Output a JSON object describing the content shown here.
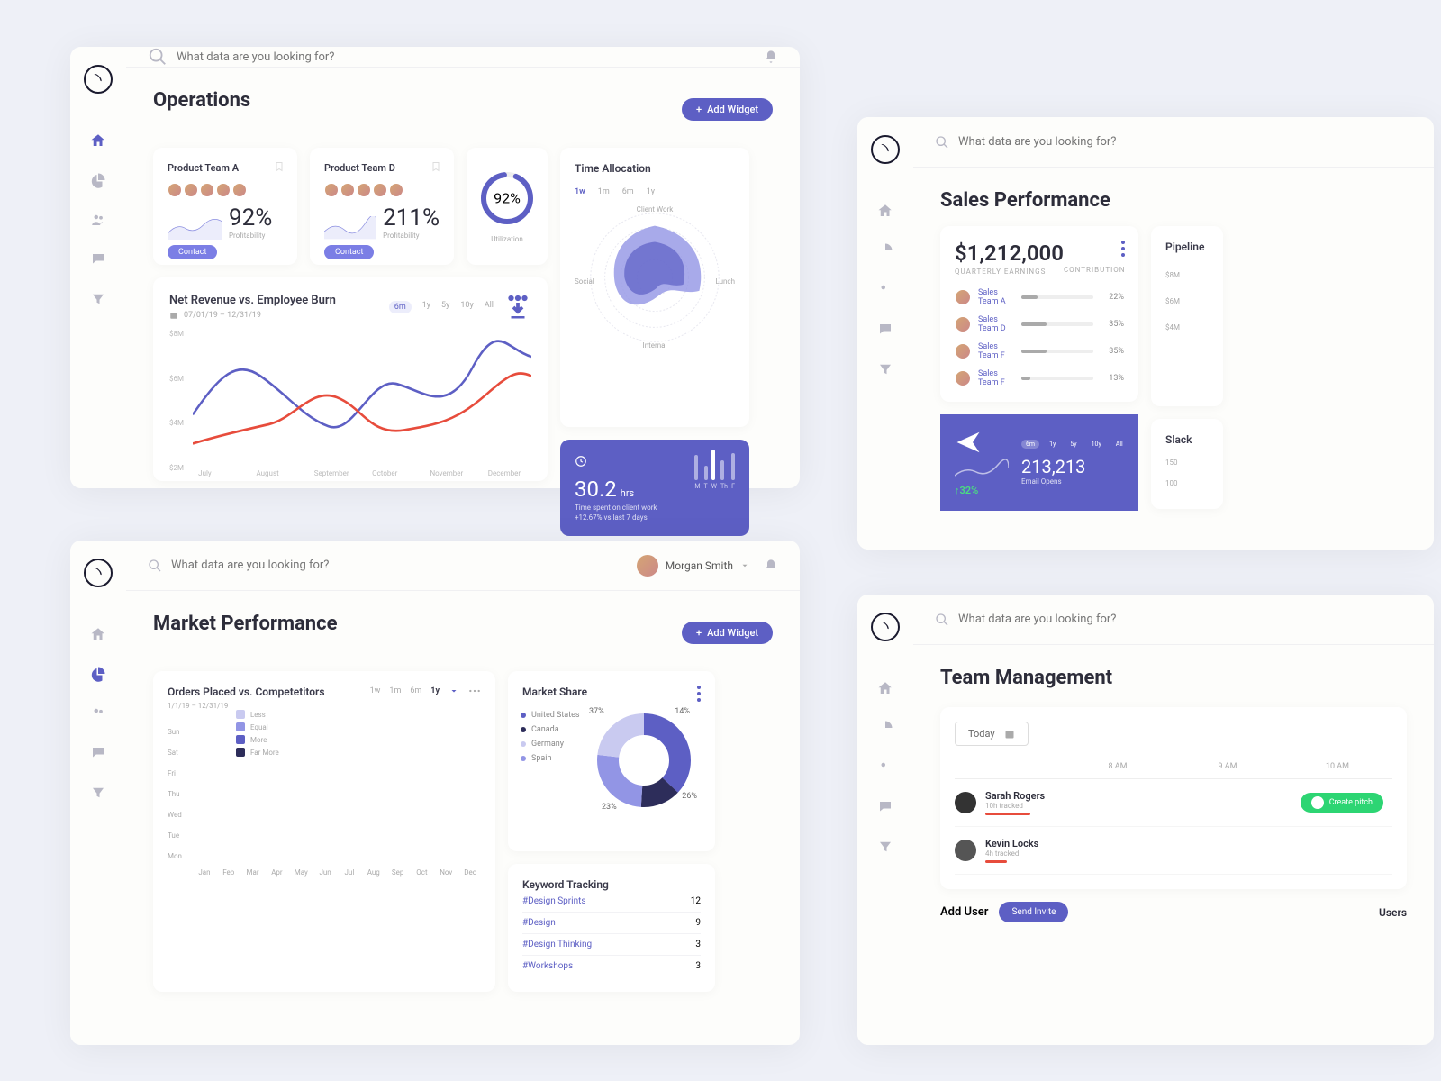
{
  "search_placeholder": "What data are you looking for?",
  "add_widget": "Add Widget",
  "contact": "Contact",
  "profitability": "Profitability",
  "panels": {
    "operations": {
      "title": "Operations",
      "teamA": {
        "name": "Product Team A",
        "value": "92%"
      },
      "teamD": {
        "name": "Product Team D",
        "value": "211%"
      },
      "utilization": {
        "value": "92%",
        "label": "Utilization"
      },
      "time_allocation": {
        "title": "Time Allocation",
        "tabs": [
          "1w",
          "1m",
          "6m",
          "1y"
        ],
        "active": "1w",
        "axes": [
          "Client Work",
          "Lunch",
          "Internal",
          "Social"
        ]
      },
      "revenue": {
        "title": "Net Revenue vs. Employee Burn",
        "date": "07/01/19 – 12/31/19",
        "tabs": [
          "6m",
          "1y",
          "5y",
          "10y",
          "All"
        ],
        "active": "6m"
      },
      "hours": {
        "value": "30.2",
        "unit": "hrs",
        "line1": "Time spent on client work",
        "line2": "+12.67% vs last 7 days",
        "days": [
          "M",
          "T",
          "W",
          "Th",
          "F"
        ]
      }
    },
    "market": {
      "title": "Market Performance",
      "user": "Morgan Smith",
      "heat": {
        "title": "Orders Placed vs. Competetitors",
        "date": "1/1/19 – 12/31/19",
        "tabs": [
          "1w",
          "1m",
          "6m",
          "1y"
        ],
        "active": "1y",
        "days": [
          "Sun",
          "Sat",
          "Fri",
          "Thu",
          "Wed",
          "Tue",
          "Mon"
        ],
        "months": [
          "Jan",
          "Feb",
          "Mar",
          "Apr",
          "May",
          "Jun",
          "Jul",
          "Aug",
          "Sep",
          "Oct",
          "Nov",
          "Dec"
        ],
        "legend": [
          "Less",
          "Equal",
          "More",
          "Far More"
        ]
      },
      "share": {
        "title": "Market Share",
        "items": [
          "United States",
          "Canada",
          "Germany",
          "Spain"
        ],
        "labels": [
          "37%",
          "14%",
          "26%",
          "23%"
        ]
      },
      "keywords": {
        "title": "Keyword Tracking",
        "rows": [
          [
            "#Design Sprints",
            "12"
          ],
          [
            "#Design",
            "9"
          ],
          [
            "#Design Thinking",
            "3"
          ],
          [
            "#Workshops",
            "3"
          ]
        ]
      }
    },
    "sales": {
      "title": "Sales Performance",
      "earnings": {
        "value": "$1,212,000",
        "label": "QUARTERLY EARNINGS",
        "contrib": "CONTRIBUTION",
        "teams": [
          [
            "Sales Team A",
            "22%"
          ],
          [
            "Sales Team D",
            "35%"
          ],
          [
            "Sales Team F",
            "13%"
          ]
        ]
      },
      "pipeline": {
        "title": "Pipeline",
        "ticks": [
          "$8M",
          "$6M",
          "$4M"
        ]
      },
      "email": {
        "growth": "32%",
        "value": "213,213",
        "label": "Email Opens",
        "tabs": [
          "6m",
          "1y",
          "5y",
          "10y",
          "All"
        ]
      },
      "slack": {
        "title": "Slack",
        "ticks": [
          "150",
          "100"
        ]
      }
    },
    "team": {
      "title": "Team Management",
      "today": "Today",
      "hours": [
        "8 AM",
        "9 AM",
        "10 AM"
      ],
      "members": [
        [
          "Sarah Rogers",
          "10h tracked"
        ],
        [
          "Kevin Locks",
          "4h tracked"
        ]
      ],
      "pitch": "Create pitch",
      "add_user": "Add User",
      "send_invite": "Send Invite",
      "users": "Users"
    }
  },
  "chart_data": [
    {
      "type": "line",
      "title": "Net Revenue vs. Employee Burn",
      "x": [
        "July",
        "August",
        "September",
        "October",
        "November",
        "December"
      ],
      "ylabel": "",
      "ylim": [
        0,
        8
      ],
      "y_ticks": [
        "$2M",
        "$4M",
        "$6M",
        "$8M"
      ],
      "series": [
        {
          "name": "Revenue",
          "color": "#5d5fc4",
          "values": [
            3.2,
            5.8,
            4.6,
            3.4,
            5.2,
            6.4
          ]
        },
        {
          "name": "Burn",
          "color": "#e74c3c",
          "values": [
            2.0,
            2.4,
            4.0,
            3.0,
            2.8,
            5.2
          ]
        }
      ]
    },
    {
      "type": "pie",
      "title": "Market Share",
      "categories": [
        "United States",
        "Canada",
        "Germany",
        "Spain"
      ],
      "values": [
        37,
        14,
        26,
        23
      ]
    },
    {
      "type": "bar",
      "title": "Hours by day",
      "categories": [
        "M",
        "T",
        "W",
        "Th",
        "F"
      ],
      "values": [
        28,
        16,
        34,
        22,
        30
      ]
    },
    {
      "type": "heatmap",
      "title": "Orders Placed vs. Competetitors",
      "rows": [
        "Sun",
        "Sat",
        "Fri",
        "Thu",
        "Wed",
        "Tue",
        "Mon"
      ],
      "cols": [
        "Jan",
        "Feb",
        "Mar",
        "Apr",
        "May",
        "Jun",
        "Jul",
        "Aug",
        "Sep",
        "Oct",
        "Nov",
        "Dec"
      ],
      "scale": [
        "Less",
        "Equal",
        "More",
        "Far More"
      ]
    }
  ]
}
